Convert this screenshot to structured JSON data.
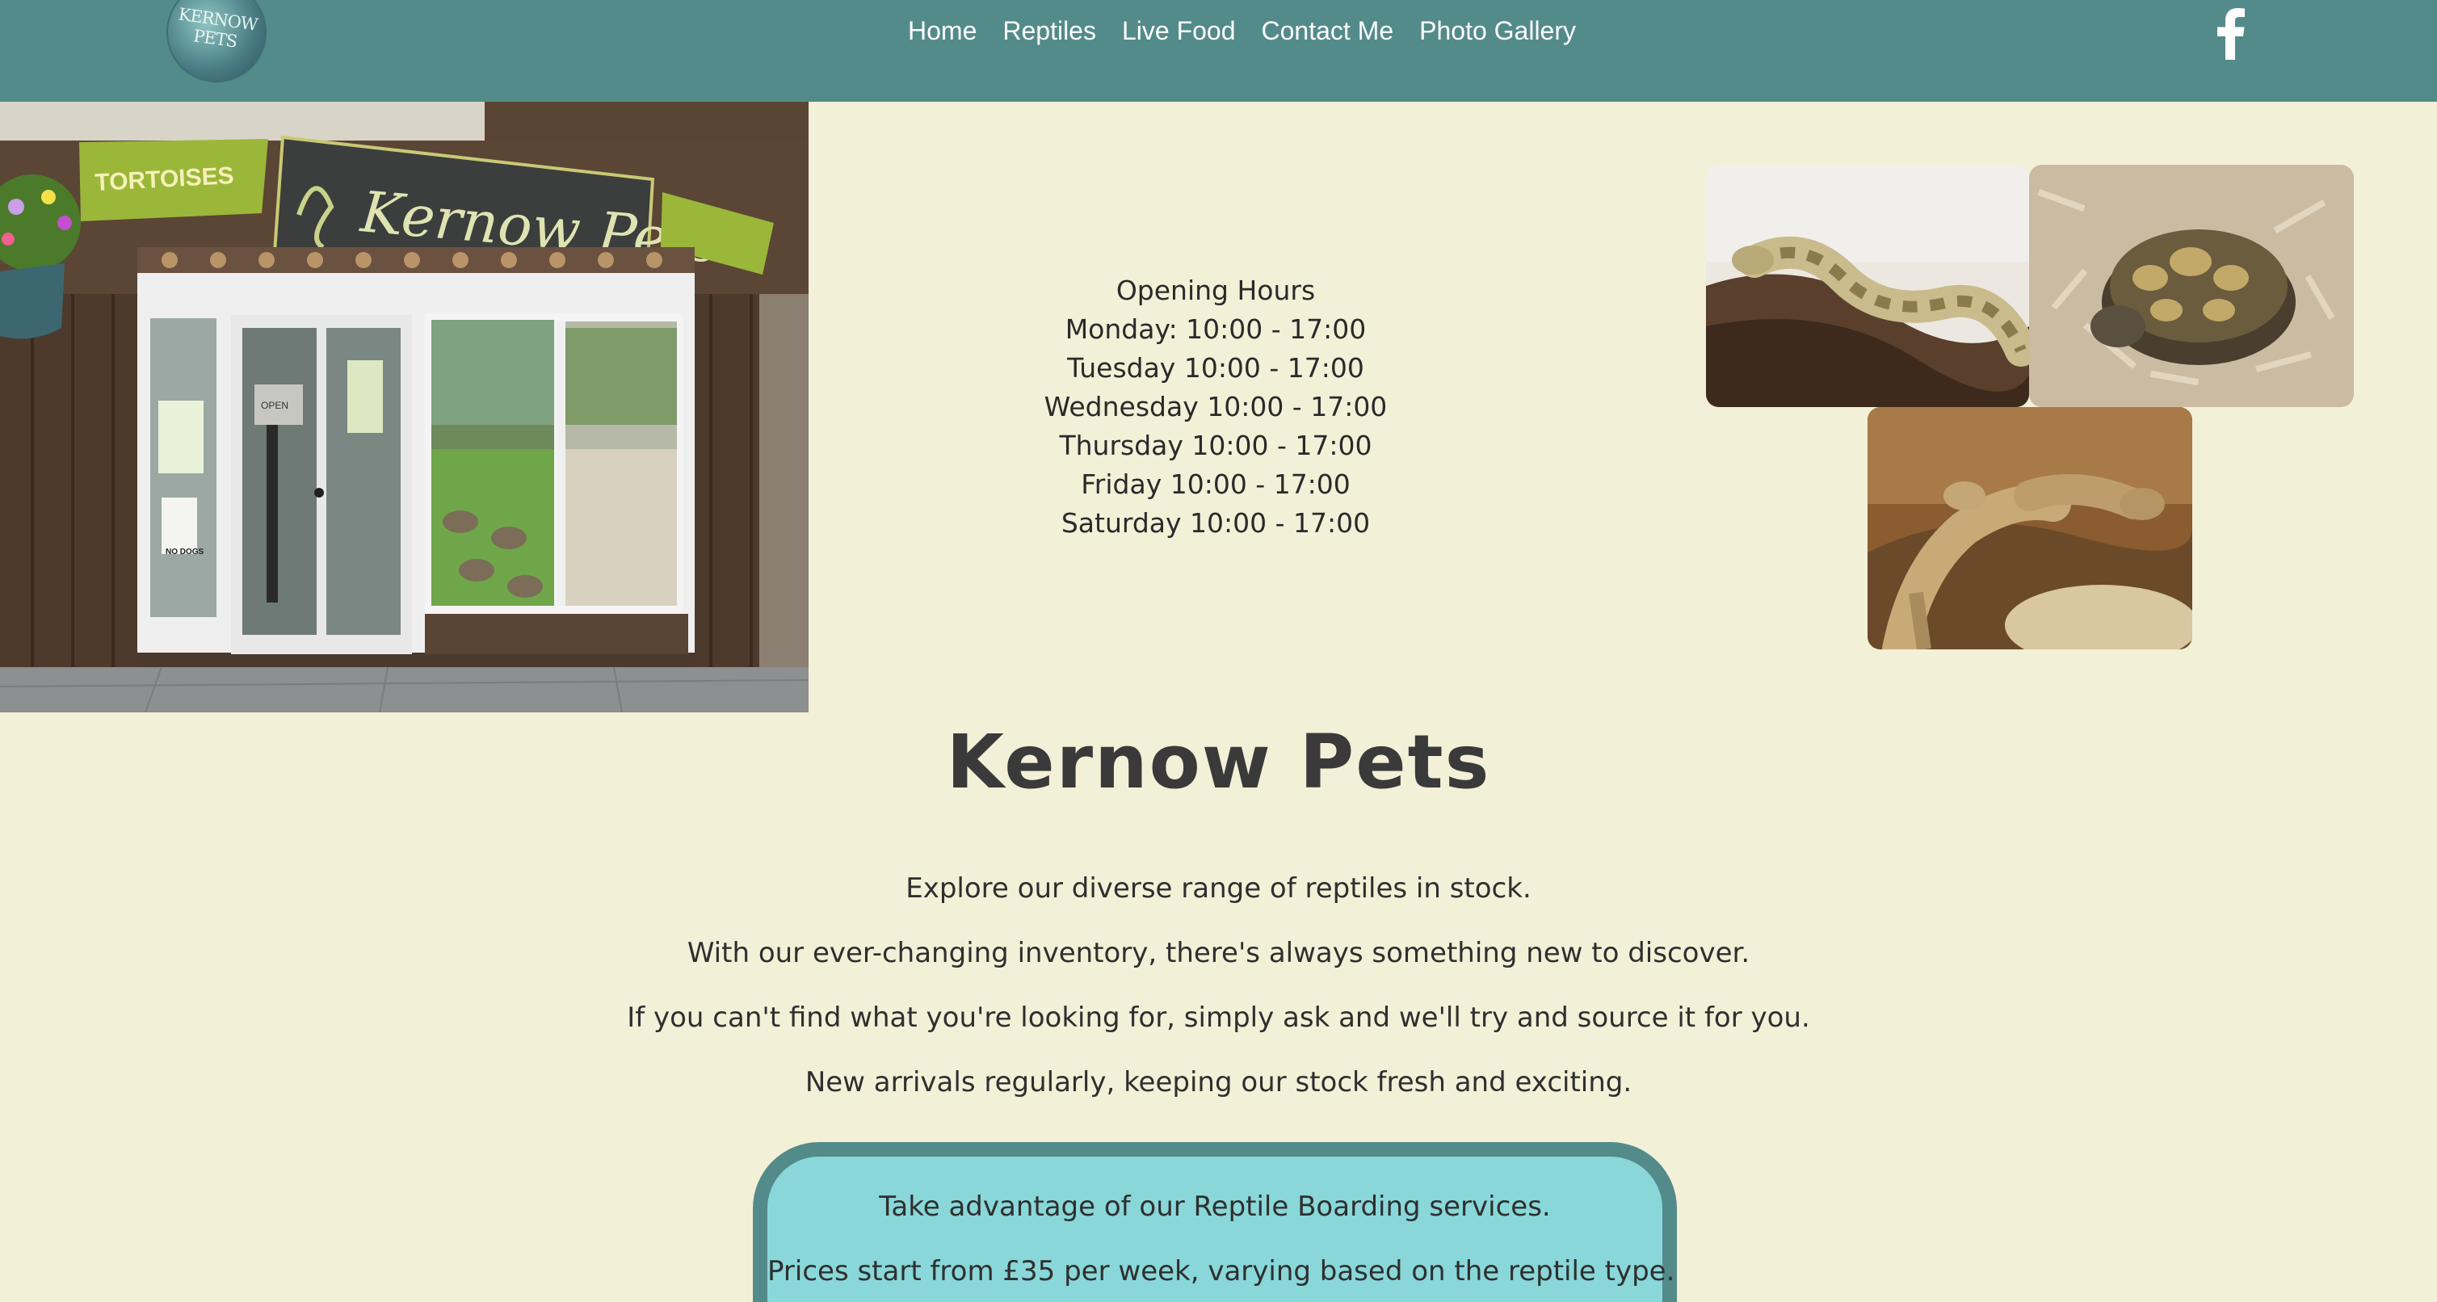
{
  "nav": {
    "logo_text": "KERNOW PETS",
    "links": [
      "Home",
      "Reptiles",
      "Live Food",
      "Contact Me",
      "Photo Gallery"
    ],
    "social_icon": "facebook-icon",
    "bg_color": "#538b8a"
  },
  "shop_photo": {
    "sign_tortoises": "TORTOISES",
    "sign_main": "Kernow Pets",
    "door_sign": "NO DOGS",
    "open_sign": "OPEN"
  },
  "hours": {
    "title": "Opening Hours",
    "lines": [
      "Monday: 10:00 - 17:00",
      "Tuesday 10:00 - 17:00",
      "Wednesday 10:00 - 17:00",
      "Thursday 10:00 - 17:00",
      "Friday 10:00 - 17:00",
      "Saturday 10:00 - 17:00"
    ]
  },
  "gallery": {
    "images": [
      "python-photo",
      "tortoise-photo",
      "bearded-dragon-photo"
    ]
  },
  "main": {
    "title": "Kernow Pets",
    "paragraphs": [
      "Explore our diverse range of reptiles in stock.",
      "With our ever-changing inventory, there's always something new to discover.",
      "If you can't find what you're looking for, simply ask and we'll try and source it for you.",
      "New arrivals regularly, keeping our stock fresh and exciting."
    ]
  },
  "boarding": {
    "line1": "Take advantage of our Reptile Boarding services.",
    "line2": "Prices start from £35 per week, varying based on the reptile type.",
    "bg_color": "#89d7d9",
    "border_color": "#538b8a"
  },
  "page_bg": "#f3f0d8"
}
